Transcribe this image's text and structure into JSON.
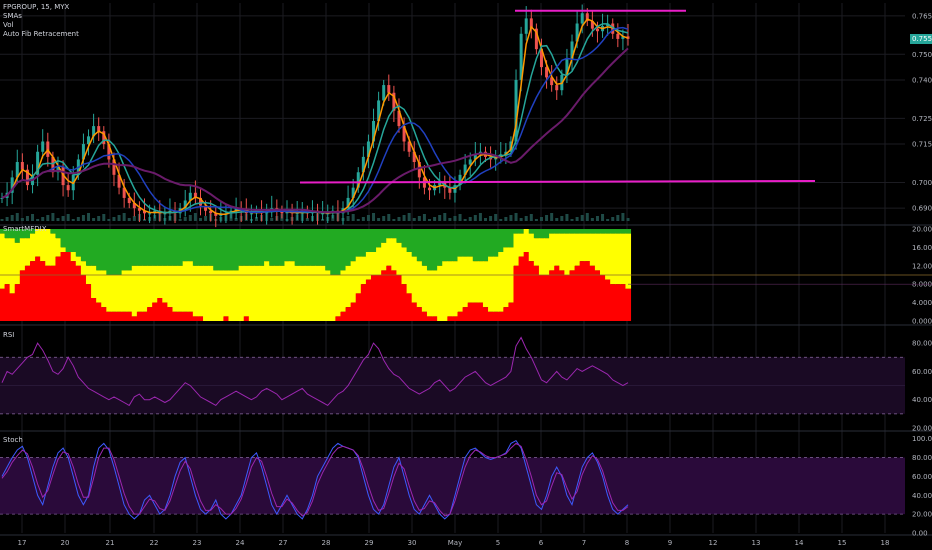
{
  "header": {
    "symbol_line": "FPGROUP, 15, MYX",
    "indicators": [
      "SMAs",
      "Vol",
      "Auto Fib Retracement"
    ]
  },
  "price_badge": {
    "label": "0.755",
    "color": "#26a69a"
  },
  "panes": {
    "mfi_title": "SmartMFDIX",
    "rsi_title": "RSI",
    "stoch_title": "Stoch"
  },
  "colors": {
    "background": "#000000",
    "grid": "#1c1c22",
    "up_candle": "#26a69a",
    "down_candle": "#ef5350",
    "resistance_line": "#e91ec8",
    "sma_fast": "#ff9800",
    "sma_mid": "#26a69a",
    "sma_slow": "#2040c0",
    "sma_long": "#6a1b6a",
    "mfi_red": "#ff0000",
    "mfi_yellow": "#ffff00",
    "mfi_green": "#22aa22",
    "rsi_line": "#9c27b0",
    "rsi_band": "#1a0a24",
    "stoch_k": "#3d5afe",
    "stoch_d": "#9c27b0",
    "stoch_band": "#2a0a3a"
  },
  "chart_data": [
    {
      "type": "candlestick",
      "pane": "price",
      "x_labels": [
        "17",
        "20",
        "21",
        "22",
        "23",
        "24",
        "27",
        "28",
        "29",
        "30",
        "May",
        "5",
        "6",
        "7",
        "8",
        "9",
        "12",
        "13",
        "14",
        "15",
        "18"
      ],
      "y_ticks": [
        "0.765",
        "0.750",
        "0.740",
        "0.725",
        "0.715",
        "0.700",
        "0.690"
      ],
      "ylim": [
        0.685,
        0.77
      ],
      "horizontal_lines": [
        {
          "y": 0.767,
          "x_from": "6",
          "x_to": "9"
        },
        {
          "y": 0.7,
          "x_from": "28",
          "x_to": "14"
        }
      ],
      "close_series": [
        0.694,
        0.696,
        0.702,
        0.708,
        0.705,
        0.699,
        0.703,
        0.712,
        0.716,
        0.71,
        0.704,
        0.706,
        0.699,
        0.697,
        0.703,
        0.709,
        0.715,
        0.718,
        0.722,
        0.72,
        0.715,
        0.709,
        0.703,
        0.698,
        0.694,
        0.692,
        0.69,
        0.689,
        0.688,
        0.688,
        0.689,
        0.688,
        0.688,
        0.689,
        0.688,
        0.69,
        0.693,
        0.696,
        0.694,
        0.691,
        0.689,
        0.688,
        0.687,
        0.688,
        0.688,
        0.689,
        0.69,
        0.689,
        0.688,
        0.688,
        0.689,
        0.688,
        0.689,
        0.69,
        0.689,
        0.688,
        0.689,
        0.688,
        0.688,
        0.689,
        0.688,
        0.689,
        0.688,
        0.688,
        0.688,
        0.689,
        0.688,
        0.69,
        0.694,
        0.698,
        0.704,
        0.71,
        0.716,
        0.724,
        0.732,
        0.738,
        0.735,
        0.728,
        0.722,
        0.716,
        0.712,
        0.708,
        0.702,
        0.698,
        0.697,
        0.699,
        0.7,
        0.698,
        0.696,
        0.699,
        0.703,
        0.707,
        0.709,
        0.711,
        0.712,
        0.71,
        0.709,
        0.71,
        0.711,
        0.712,
        0.716,
        0.74,
        0.758,
        0.764,
        0.76,
        0.752,
        0.745,
        0.741,
        0.738,
        0.736,
        0.742,
        0.748,
        0.755,
        0.762,
        0.766,
        0.763,
        0.76,
        0.759,
        0.761,
        0.762,
        0.758,
        0.756,
        0.757,
        0.756
      ]
    },
    {
      "type": "area",
      "pane": "SmartMFDIX",
      "y_ticks": [
        "20.00",
        "16.000",
        "12.000",
        "8.000",
        "4.000",
        "0.000"
      ],
      "ylim": [
        0,
        20
      ],
      "note": "stacked bands: red bottom, yellow middle, green top",
      "red_series": [
        7,
        8,
        6,
        8,
        11,
        12,
        13,
        14,
        13,
        12,
        12,
        14,
        15,
        15,
        13,
        12,
        10,
        8,
        5,
        4,
        3,
        2,
        2,
        2,
        2,
        2,
        1,
        2,
        2,
        3,
        4,
        5,
        4,
        3,
        2,
        2,
        2,
        2,
        1,
        1,
        0,
        0,
        0,
        0,
        1,
        0,
        0,
        0,
        1,
        0,
        0,
        0,
        0,
        0,
        0,
        0,
        0,
        0,
        0,
        0,
        0,
        0,
        0,
        0,
        0,
        0,
        1,
        2,
        3,
        4,
        6,
        8,
        9,
        10,
        10,
        11,
        12,
        11,
        10,
        8,
        6,
        4,
        3,
        2,
        1,
        1,
        0,
        0,
        1,
        1,
        2,
        3,
        4,
        4,
        4,
        3,
        2,
        2,
        2,
        3,
        4,
        12,
        14,
        15,
        13,
        12,
        10,
        10,
        11,
        12,
        11,
        10,
        11,
        12,
        13,
        13,
        12,
        11,
        10,
        9,
        8,
        8,
        8,
        7
      ],
      "yellow_top_series": [
        19,
        18,
        18,
        17,
        18,
        18,
        19,
        20,
        20,
        20,
        19,
        18,
        16,
        15,
        15,
        14,
        13,
        12,
        12,
        11,
        11,
        10,
        10,
        10,
        11,
        11,
        12,
        12,
        12,
        12,
        12,
        12,
        12,
        12,
        12,
        12,
        13,
        13,
        12,
        12,
        12,
        12,
        11,
        11,
        11,
        11,
        11,
        12,
        12,
        12,
        12,
        12,
        13,
        12,
        12,
        12,
        13,
        13,
        12,
        12,
        12,
        12,
        12,
        12,
        11,
        10,
        10,
        11,
        12,
        13,
        14,
        14,
        15,
        15,
        16,
        17,
        18,
        18,
        17,
        16,
        15,
        14,
        13,
        12,
        11,
        11,
        12,
        13,
        13,
        13,
        14,
        14,
        14,
        13,
        13,
        13,
        14,
        14,
        15,
        16,
        16,
        19,
        19,
        20,
        19,
        18,
        18,
        18,
        19,
        19,
        19,
        19,
        19,
        19,
        19,
        19,
        19,
        19,
        19,
        19,
        19,
        19,
        19,
        19
      ]
    },
    {
      "type": "line",
      "pane": "RSI",
      "y_ticks": [
        "80.00",
        "60.00",
        "40.00",
        "20.00"
      ],
      "ylim": [
        20,
        90
      ],
      "bands": [
        30,
        70
      ],
      "values": [
        52,
        60,
        58,
        62,
        66,
        70,
        72,
        80,
        75,
        68,
        60,
        58,
        62,
        70,
        64,
        56,
        52,
        48,
        46,
        44,
        42,
        40,
        42,
        40,
        38,
        36,
        42,
        44,
        40,
        40,
        42,
        40,
        38,
        40,
        44,
        48,
        52,
        50,
        46,
        42,
        40,
        38,
        36,
        40,
        42,
        44,
        46,
        44,
        42,
        40,
        42,
        46,
        48,
        46,
        44,
        40,
        42,
        44,
        46,
        48,
        44,
        42,
        40,
        38,
        36,
        40,
        44,
        46,
        50,
        56,
        62,
        68,
        72,
        80,
        76,
        68,
        62,
        58,
        56,
        52,
        48,
        46,
        44,
        46,
        48,
        52,
        54,
        50,
        46,
        48,
        52,
        56,
        58,
        60,
        56,
        52,
        50,
        52,
        54,
        56,
        60,
        78,
        84,
        76,
        70,
        62,
        54,
        52,
        56,
        60,
        56,
        54,
        58,
        62,
        60,
        62,
        64,
        62,
        60,
        58,
        54,
        52,
        50,
        52
      ]
    },
    {
      "type": "line",
      "pane": "Stoch",
      "y_ticks": [
        "100.00",
        "80.00",
        "60.00",
        "40.00",
        "20.00",
        "0.00"
      ],
      "ylim": [
        0,
        105
      ],
      "bands": [
        20,
        80
      ],
      "series": [
        {
          "values": [
            60,
            70,
            80,
            88,
            92,
            80,
            60,
            40,
            30,
            50,
            70,
            85,
            90,
            80,
            60,
            40,
            30,
            40,
            70,
            90,
            95,
            88,
            70,
            50,
            30,
            20,
            15,
            20,
            35,
            40,
            30,
            20,
            25,
            40,
            60,
            75,
            80,
            60,
            40,
            25,
            20,
            25,
            35,
            20,
            15,
            20,
            30,
            40,
            60,
            80,
            85,
            70,
            50,
            30,
            20,
            30,
            40,
            30,
            20,
            15,
            25,
            40,
            60,
            70,
            80,
            90,
            95,
            92,
            90,
            88,
            80,
            60,
            40,
            25,
            20,
            30,
            50,
            70,
            80,
            60,
            40,
            25,
            20,
            30,
            40,
            30,
            20,
            15,
            20,
            40,
            60,
            80,
            88,
            90,
            85,
            80,
            78,
            80,
            82,
            85,
            95,
            98,
            90,
            70,
            50,
            30,
            25,
            40,
            60,
            70,
            60,
            40,
            30,
            50,
            70,
            80,
            85,
            75,
            60,
            40,
            25,
            20,
            25,
            30
          ]
        },
        {
          "values": [
            58,
            65,
            75,
            82,
            88,
            84,
            70,
            52,
            38,
            45,
            62,
            78,
            86,
            84,
            70,
            52,
            38,
            38,
            58,
            80,
            90,
            90,
            78,
            60,
            42,
            28,
            20,
            20,
            28,
            36,
            34,
            26,
            24,
            34,
            50,
            66,
            76,
            68,
            50,
            34,
            24,
            24,
            30,
            26,
            20,
            20,
            26,
            36,
            52,
            70,
            80,
            76,
            60,
            42,
            28,
            28,
            36,
            32,
            24,
            18,
            22,
            34,
            52,
            64,
            74,
            84,
            90,
            92,
            90,
            88,
            82,
            68,
            50,
            34,
            24,
            26,
            42,
            60,
            74,
            68,
            50,
            34,
            24,
            26,
            34,
            32,
            24,
            18,
            20,
            34,
            52,
            70,
            82,
            88,
            86,
            82,
            80,
            80,
            82,
            84,
            90,
            95,
            92,
            78,
            60,
            40,
            30,
            34,
            50,
            64,
            62,
            48,
            36,
            44,
            62,
            74,
            82,
            78,
            66,
            48,
            32,
            24,
            24,
            28
          ]
        }
      ]
    }
  ]
}
